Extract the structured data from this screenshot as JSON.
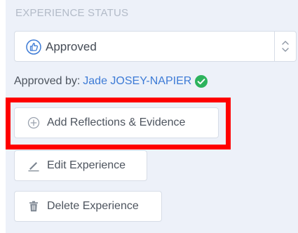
{
  "section": {
    "title": "EXPERIENCE STATUS"
  },
  "status": {
    "value": "Approved",
    "icon": "thumbs-up-icon"
  },
  "approval": {
    "prefix": "Approved by:",
    "approver": "Jade JOSEY-NAPIER",
    "badge_icon": "check-circle-icon"
  },
  "actions": {
    "add_label": "Add Reflections & Evidence",
    "add_icon": "plus-circle-icon",
    "edit_label": "Edit Experience",
    "edit_icon": "pencil-icon",
    "delete_label": "Delete Experience",
    "delete_icon": "trash-icon"
  },
  "colors": {
    "panel_bg": "#edf1f9",
    "link": "#3d7bd6",
    "check_green": "#2db35d",
    "highlight": "#ff0000"
  }
}
